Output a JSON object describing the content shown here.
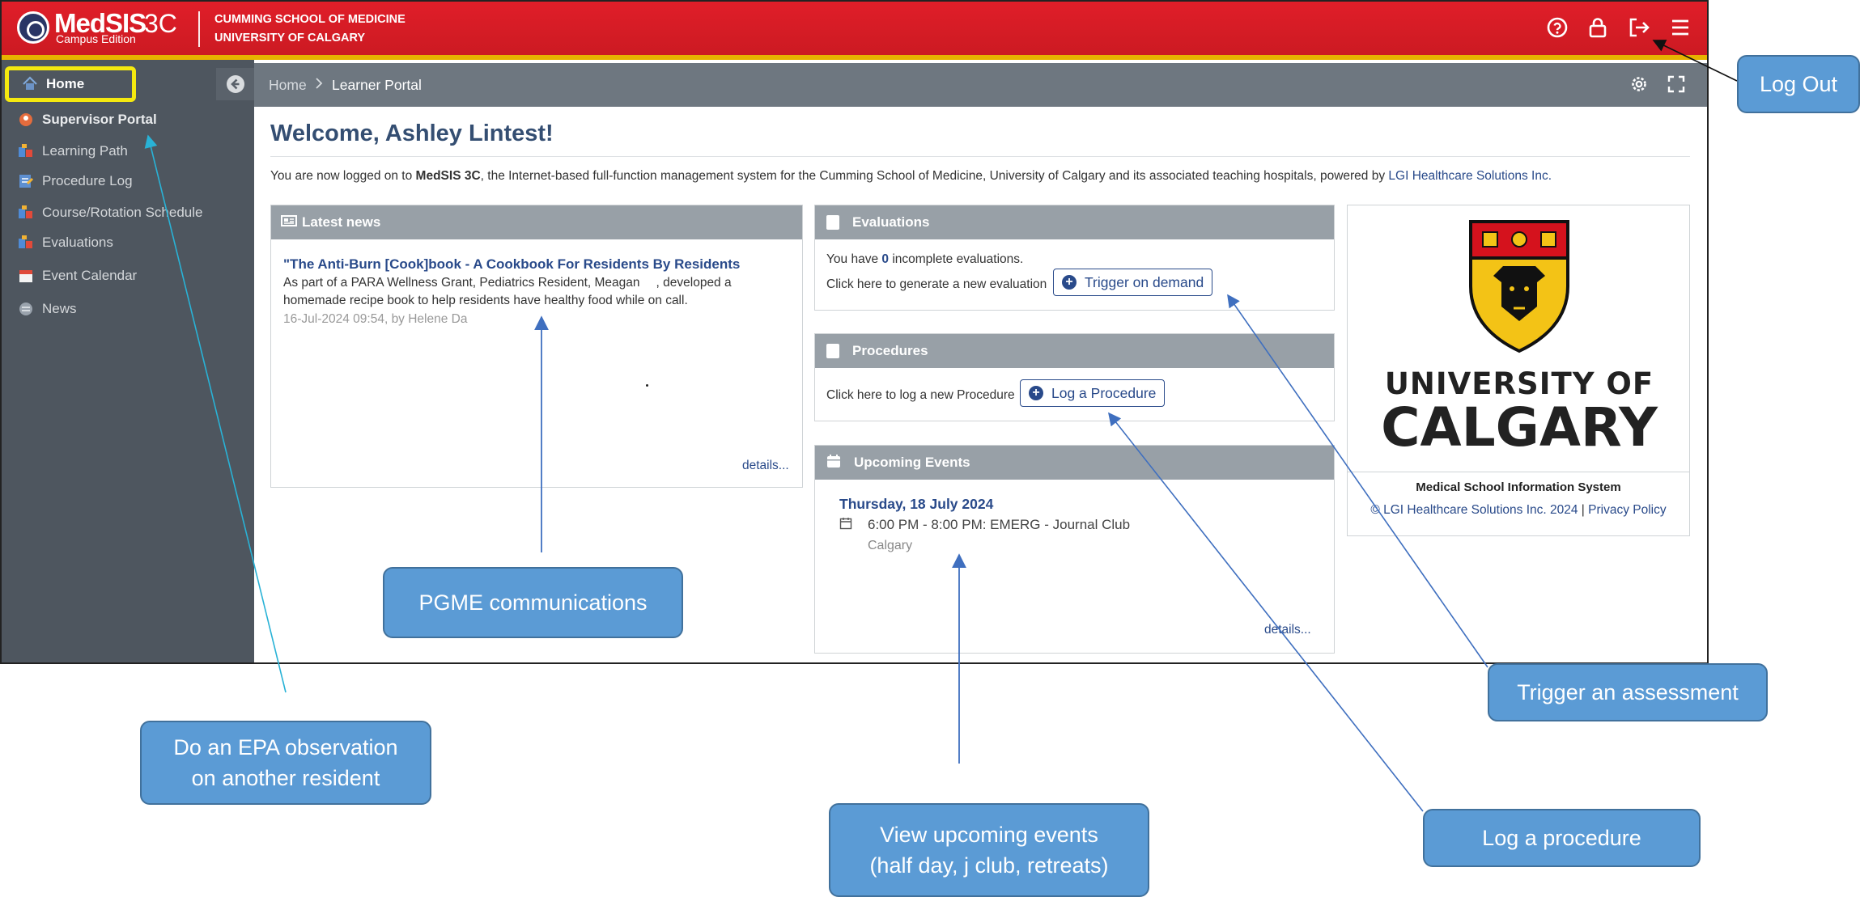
{
  "header": {
    "brand_name": "MedSIS",
    "brand_version": "3C",
    "brand_edition": "Campus Edition",
    "school_line1": "CUMMING SCHOOL OF MEDICINE",
    "school_line2": "UNIVERSITY OF CALGARY",
    "icons": [
      "help-icon",
      "lock-icon",
      "logout-icon",
      "menu-icon"
    ],
    "colors": {
      "bar": "#e01e29",
      "accent_stripe": "#e7b200"
    }
  },
  "sidebar": {
    "items": [
      {
        "label": "Home",
        "icon": "home-icon",
        "highlighted": true
      },
      {
        "label": "Supervisor Portal",
        "icon": "supervisor-icon"
      },
      {
        "label": "Learning Path",
        "icon": "learning-path-icon"
      },
      {
        "label": "Procedure Log",
        "icon": "procedure-log-icon"
      },
      {
        "label": "Course/Rotation Schedule",
        "icon": "schedule-icon"
      },
      {
        "label": "Evaluations",
        "icon": "evaluations-icon"
      },
      {
        "label": "Event Calendar",
        "icon": "calendar-icon"
      },
      {
        "label": "News",
        "icon": "news-icon"
      }
    ]
  },
  "breadcrumb": {
    "home": "Home",
    "current": "Learner Portal"
  },
  "main": {
    "welcome": "Welcome, Ashley Lintest!",
    "intro_prefix": "You are now logged on to ",
    "intro_product": "MedSIS 3C",
    "intro_mid": ", the Internet-based full-function management system for the Cumming School of Medicine, University of Calgary and its associated teaching hospitals, powered by ",
    "intro_link": "LGI Healthcare Solutions Inc.",
    "news": {
      "heading": "Latest news",
      "title": "\"The Anti-Burn [Cook]book - A Cookbook For Residents By Residents",
      "body_line1": "As part of a PARA Wellness Grant, Pediatrics Resident, Meagan",
      "body_line1b": ", developed a",
      "body_line2": "homemade recipe book to help residents have healthy food while on call.",
      "meta": "16-Jul-2024 09:54, by Helene Da",
      "details": "details..."
    },
    "evaluations": {
      "heading": "Evaluations",
      "line1_prefix": "You have ",
      "line1_count": "0",
      "line1_suffix": " incomplete evaluations.",
      "line2": "Click here to generate a new evaluation",
      "button": "Trigger on demand"
    },
    "procedures": {
      "heading": "Procedures",
      "line": "Click here to log a new Procedure",
      "button": "Log a Procedure"
    },
    "events": {
      "heading": "Upcoming Events",
      "date": "Thursday, 18 July 2024",
      "event": "6:00 PM - 8:00 PM: EMERG - Journal Club",
      "location": "Calgary",
      "details": "details..."
    },
    "university": {
      "logo_line1": "UNIVERSITY OF",
      "logo_line2": "CALGARY",
      "system": "Medical School Information System",
      "copyright": "© LGI Healthcare Solutions Inc. 2024",
      "sep": " | ",
      "privacy": "Privacy Policy"
    }
  },
  "annotations": {
    "logout": "Log Out",
    "pgme": "PGME communications",
    "epa_line1": "Do an EPA observation",
    "epa_line2": "on another resident",
    "events_line1": "View upcoming events",
    "events_line2": "(half day, j club, retreats)",
    "trigger": "Trigger an assessment",
    "procedure": "Log a procedure",
    "callout_color": "#5b9bd5"
  }
}
